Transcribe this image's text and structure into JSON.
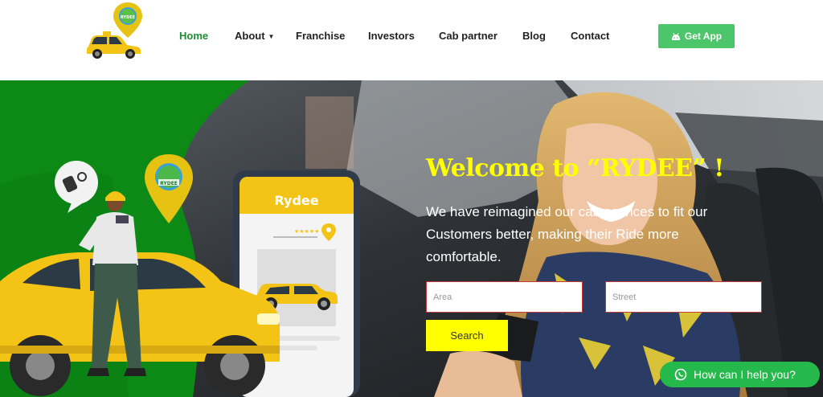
{
  "logo": {
    "alt": "Rydee cab logo",
    "pin_text": "RYDEE"
  },
  "nav": {
    "items": [
      {
        "label": "Home",
        "active": true
      },
      {
        "label": "About",
        "has_dropdown": true
      },
      {
        "label": "Franchise"
      },
      {
        "label": "Investors"
      },
      {
        "label": "Cab partner"
      },
      {
        "label": "Blog"
      },
      {
        "label": "Contact"
      }
    ],
    "get_app_label": "Get App",
    "get_app_icon": "android-icon"
  },
  "hero": {
    "title": "Welcome to “RYDEE” !",
    "subtitle": "We have reimagined our cab services to fit our Customers better, making their Ride more comfortable.",
    "phone_brand": "Rydee",
    "pin_text": "RYDEE",
    "area_placeholder": "Area",
    "street_placeholder": "Street",
    "search_label": "Search"
  },
  "whatsapp": {
    "label": "How can I help you?",
    "icon": "whatsapp-icon"
  },
  "colors": {
    "brand_green": "#1f8a2f",
    "hero_green": "#0d8a16",
    "title_yellow": "#ffff00",
    "taxi_yellow": "#f3c316",
    "app_button": "#4dc66b",
    "whatsapp": "#25b84a"
  }
}
